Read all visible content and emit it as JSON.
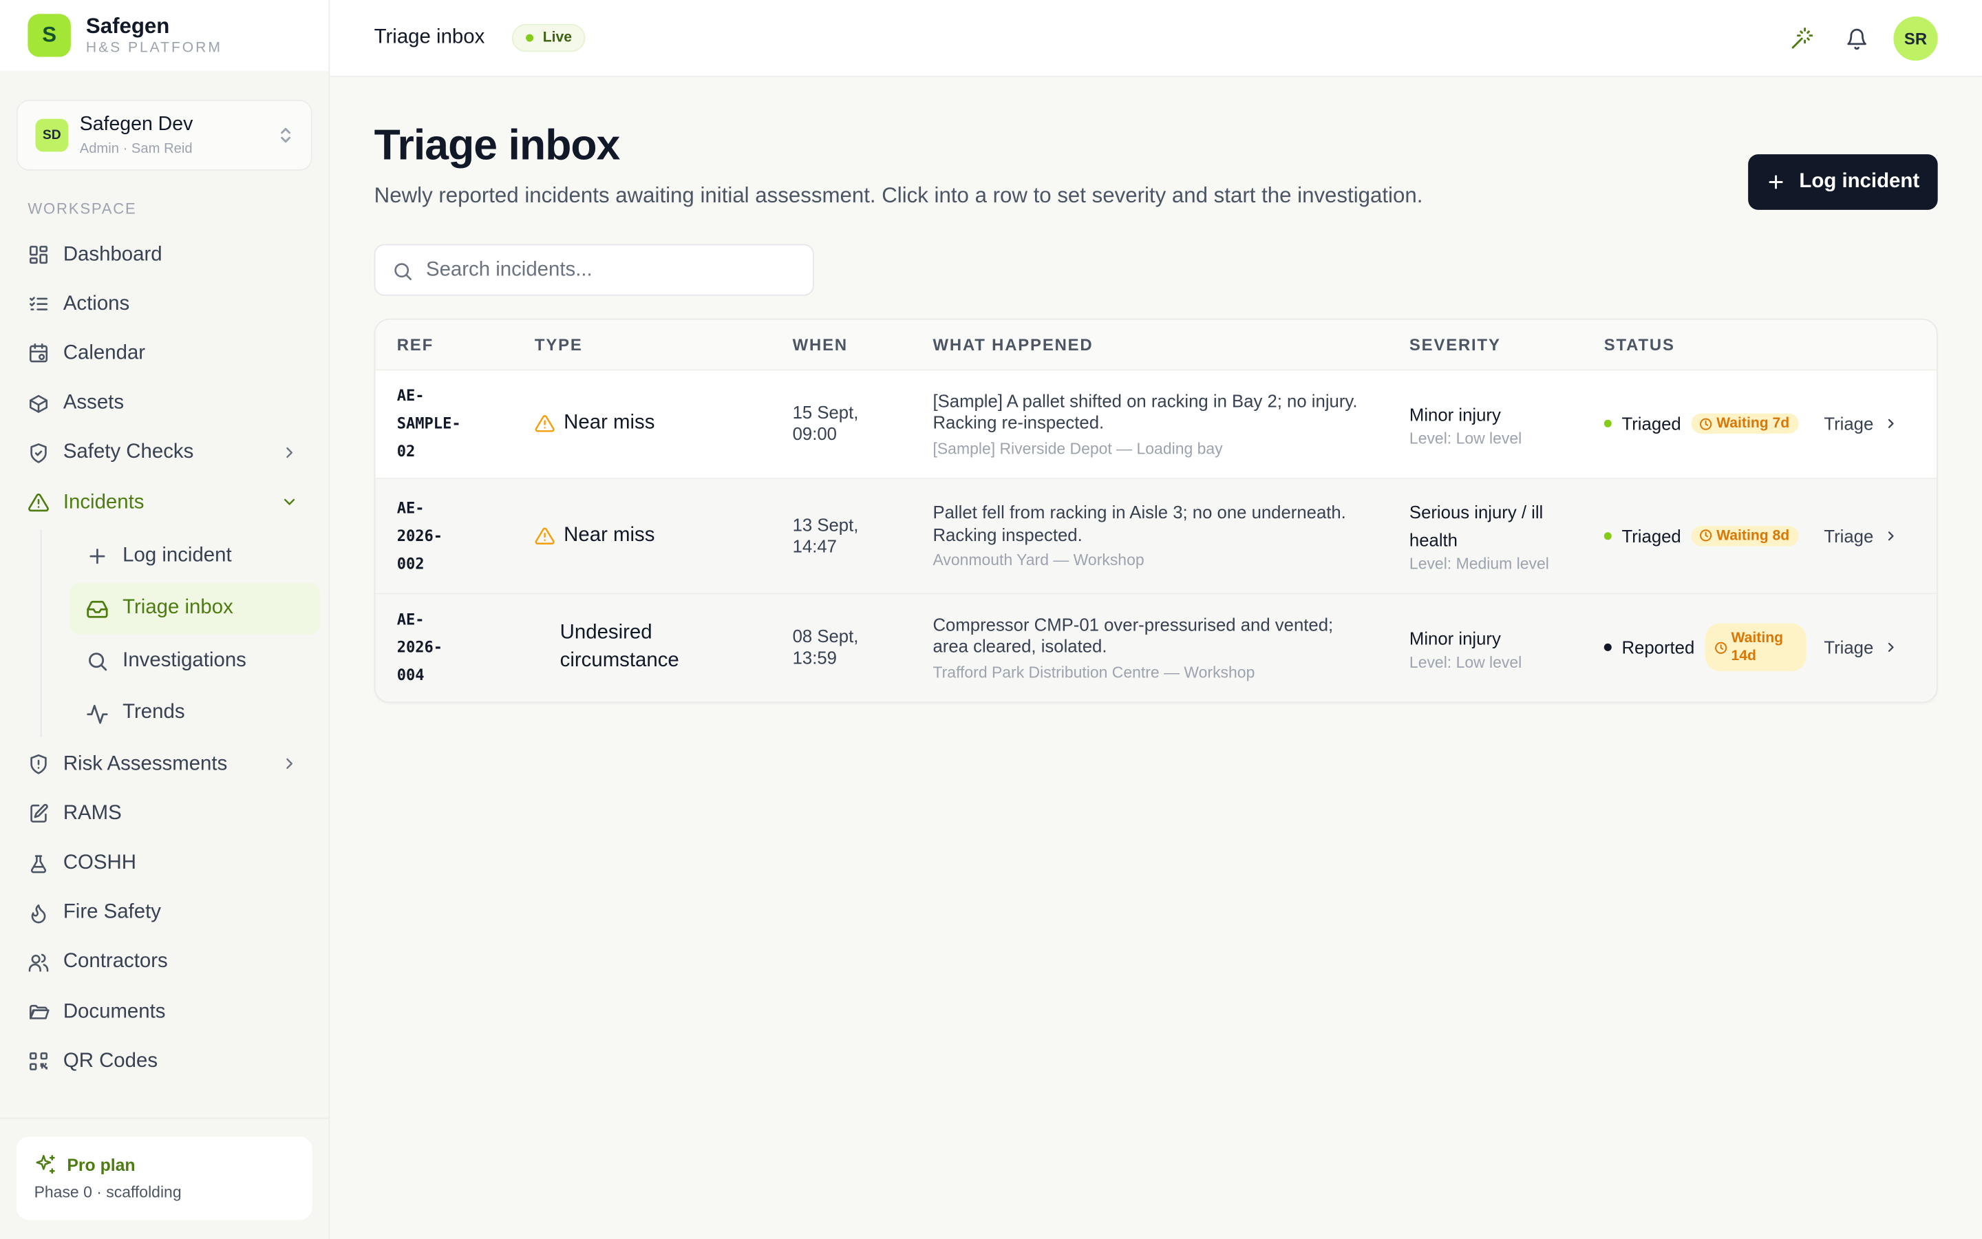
{
  "brand": {
    "logo_letter": "S",
    "name": "Safegen",
    "subtitle": "H&S PLATFORM"
  },
  "org": {
    "avatar": "SD",
    "name": "Safegen Dev",
    "role": "Admin · Sam Reid"
  },
  "sidebar": {
    "section_label": "WORKSPACE",
    "items": [
      {
        "label": "Dashboard",
        "icon": "dashboard-icon"
      },
      {
        "label": "Actions",
        "icon": "list-checks-icon"
      },
      {
        "label": "Calendar",
        "icon": "calendar-icon"
      },
      {
        "label": "Assets",
        "icon": "box-icon"
      },
      {
        "label": "Safety Checks",
        "icon": "shield-check-icon"
      },
      {
        "label": "Incidents",
        "icon": "warning-triangle-icon"
      },
      {
        "label": "Risk Assessments",
        "icon": "shield-alert-icon"
      },
      {
        "label": "RAMS",
        "icon": "file-edit-icon"
      },
      {
        "label": "COSHH",
        "icon": "flask-icon"
      },
      {
        "label": "Fire Safety",
        "icon": "flame-icon"
      },
      {
        "label": "Contractors",
        "icon": "users-icon"
      },
      {
        "label": "Documents",
        "icon": "folder-icon"
      },
      {
        "label": "QR Codes",
        "icon": "qr-code-icon"
      }
    ],
    "incidents_sub": [
      {
        "label": "Log incident",
        "icon": "plus-icon"
      },
      {
        "label": "Triage inbox",
        "icon": "inbox-icon"
      },
      {
        "label": "Investigations",
        "icon": "search-icon"
      },
      {
        "label": "Trends",
        "icon": "activity-icon"
      }
    ],
    "plan": {
      "title": "Pro plan",
      "subtitle": "Phase 0 · scaffolding"
    }
  },
  "topbar": {
    "title": "Triage inbox",
    "live": "Live",
    "avatar": "SR"
  },
  "page": {
    "title": "Triage inbox",
    "description": "Newly reported incidents awaiting initial assessment. Click into a row to set severity and start the investigation.",
    "log_button": "Log incident",
    "search_placeholder": "Search incidents..."
  },
  "table": {
    "headers": [
      "REF",
      "TYPE",
      "WHEN",
      "WHAT HAPPENED",
      "SEVERITY",
      "STATUS",
      ""
    ],
    "rows": [
      {
        "ref": "AE-SAMPLE-02",
        "type": "Near miss",
        "when": "15 Sept, 09:00",
        "what": "[Sample] A pallet shifted on racking in Bay 2; no injury. Racking re-inspected.",
        "location": "[Sample] Riverside Depot — Loading bay",
        "severity": "Minor injury",
        "level": "Level: Low level",
        "status": "Triaged",
        "waiting": "Waiting 7d",
        "action": "Triage"
      },
      {
        "ref": "AE-2026-002",
        "type": "Near miss",
        "when": "13 Sept, 14:47",
        "what": "Pallet fell from racking in Aisle 3; no one underneath. Racking inspected.",
        "location": "Avonmouth Yard — Workshop",
        "severity": "Serious injury / ill health",
        "level": "Level: Medium level",
        "status": "Triaged",
        "waiting": "Waiting 8d",
        "action": "Triage"
      },
      {
        "ref": "AE-2026-004",
        "type": "Undesired circumstance",
        "when": "08 Sept, 13:59",
        "what": "Compressor CMP-01 over-pressurised and vented; area cleared, isolated.",
        "location": "Trafford Park Distribution Centre — Workshop",
        "severity": "Minor injury",
        "level": "Level: Low level",
        "status": "Reported",
        "waiting": "Waiting 14d",
        "action": "Triage"
      }
    ]
  },
  "colors": {
    "accent": "#a3e635",
    "accent_text": "#4d7c0f",
    "dark_button": "#111827",
    "warning_badge_bg": "#fef3c7",
    "warning_badge_text": "#d97706",
    "status_triaged_dot": "#84cc16",
    "status_reported_dot": "#111827"
  }
}
